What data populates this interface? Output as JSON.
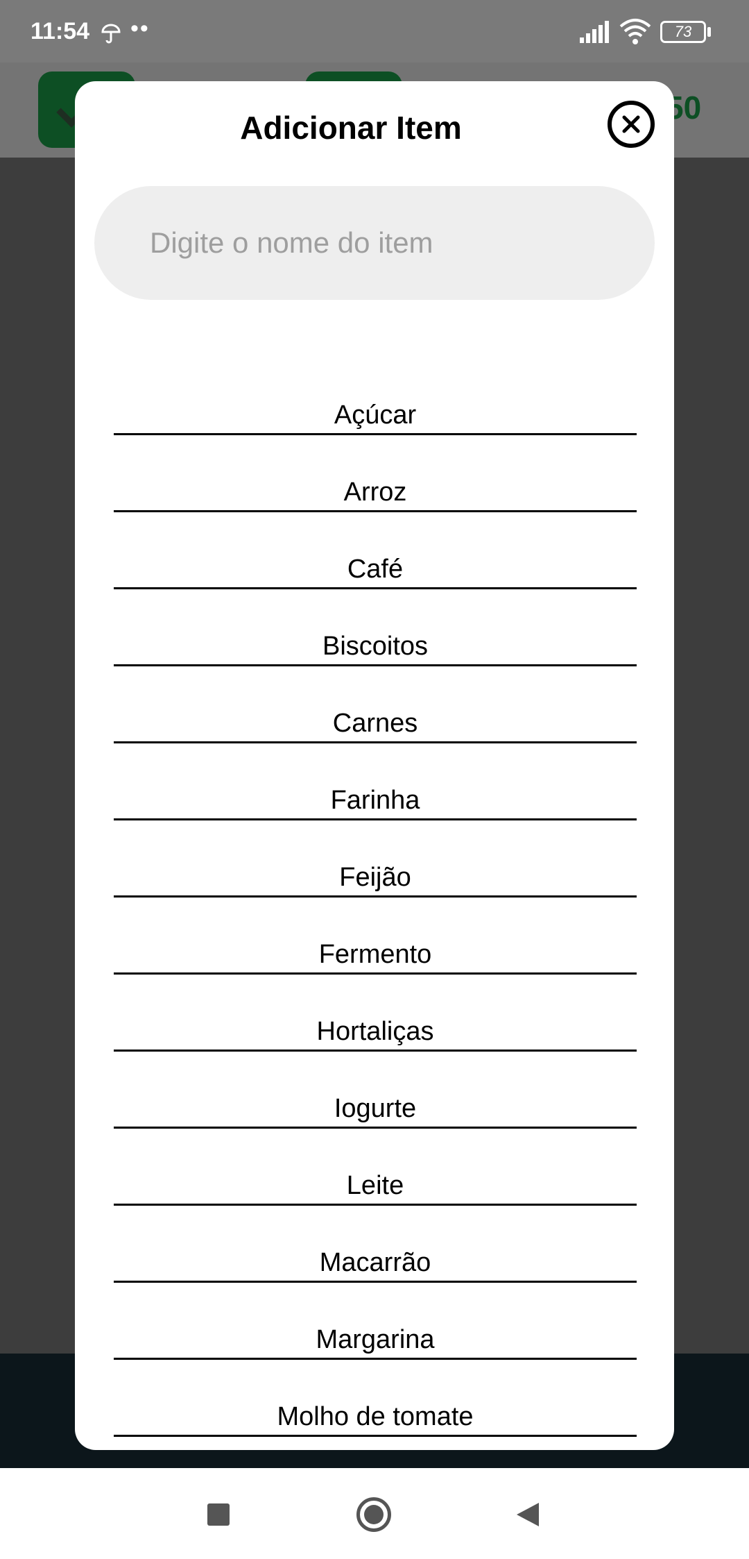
{
  "status_bar": {
    "time": "11:54",
    "extra": "••",
    "battery": "73"
  },
  "background_app": {
    "header_value": "50"
  },
  "modal": {
    "title": "Adicionar Item",
    "search_placeholder": "Digite o nome do item",
    "search_value": "",
    "items": [
      "Açúcar",
      "Arroz",
      "Café",
      "Biscoitos",
      "Carnes",
      "Farinha",
      "Feijão",
      "Fermento",
      "Hortaliças",
      "Iogurte",
      "Leite",
      "Macarrão",
      "Margarina",
      "Molho de tomate"
    ]
  },
  "colors": {
    "accent_green": "#0d4f24",
    "overlay": "#3d3d3d",
    "modal_bg": "#ffffff",
    "search_bg": "#eeeeee"
  },
  "icons": {
    "close": "close-circle-icon",
    "nav_recent": "square-icon",
    "nav_home": "home-circle-icon",
    "nav_back": "back-triangle-icon"
  }
}
